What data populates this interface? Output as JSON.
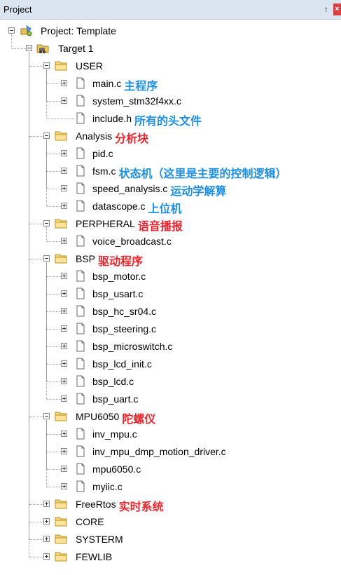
{
  "panel": {
    "title": "Project",
    "pin_glyph": "ᵖ",
    "close_glyph": "×"
  },
  "tree": [
    {
      "label": "Project: Template",
      "icon": "project-icon",
      "expander": "minus",
      "level": 0
    },
    {
      "label": "Target 1",
      "icon": "target-icon",
      "expander": "minus",
      "level": 1
    },
    {
      "label": "USER",
      "icon": "folder-icon",
      "expander": "minus",
      "level": 2
    },
    {
      "label": "main.c",
      "icon": "file-icon",
      "expander": "plus",
      "level": 3,
      "note": "主程序",
      "note_color": "blue"
    },
    {
      "label": "system_stm32f4xx.c",
      "icon": "file-icon",
      "expander": "plus",
      "level": 3
    },
    {
      "label": "include.h",
      "icon": "file-icon",
      "expander": "none",
      "level": 3,
      "note": "所有的头文件",
      "note_color": "blue"
    },
    {
      "label": "Analysis",
      "icon": "folder-icon",
      "expander": "minus",
      "level": 2,
      "note": "分析块",
      "note_color": "red"
    },
    {
      "label": "pid.c",
      "icon": "file-icon",
      "expander": "plus",
      "level": 3
    },
    {
      "label": "fsm.c",
      "icon": "file-icon",
      "expander": "plus",
      "level": 3,
      "note": "状态机（这里是主要的控制逻辑）",
      "note_color": "blue"
    },
    {
      "label": "speed_analysis.c",
      "icon": "file-icon",
      "expander": "plus",
      "level": 3,
      "note": "运动学解算",
      "note_color": "blue"
    },
    {
      "label": "datascope.c",
      "icon": "file-icon",
      "expander": "plus",
      "level": 3,
      "note": "上位机",
      "note_color": "blue"
    },
    {
      "label": "PERPHERAL",
      "icon": "folder-icon",
      "expander": "minus",
      "level": 2,
      "note": "语音播报",
      "note_color": "red"
    },
    {
      "label": "voice_broadcast.c",
      "icon": "file-icon",
      "expander": "plus",
      "level": 3
    },
    {
      "label": "BSP",
      "icon": "folder-icon",
      "expander": "minus",
      "level": 2,
      "note": "驱动程序",
      "note_color": "red"
    },
    {
      "label": "bsp_motor.c",
      "icon": "file-icon",
      "expander": "plus",
      "level": 3
    },
    {
      "label": "bsp_usart.c",
      "icon": "file-icon",
      "expander": "plus",
      "level": 3
    },
    {
      "label": "bsp_hc_sr04.c",
      "icon": "file-icon",
      "expander": "plus",
      "level": 3
    },
    {
      "label": "bsp_steering.c",
      "icon": "file-icon",
      "expander": "plus",
      "level": 3
    },
    {
      "label": "bsp_microswitch.c",
      "icon": "file-icon",
      "expander": "plus",
      "level": 3
    },
    {
      "label": "bsp_lcd_init.c",
      "icon": "file-icon",
      "expander": "plus",
      "level": 3
    },
    {
      "label": "bsp_lcd.c",
      "icon": "file-icon",
      "expander": "plus",
      "level": 3
    },
    {
      "label": "bsp_uart.c",
      "icon": "file-icon",
      "expander": "plus",
      "level": 3
    },
    {
      "label": "MPU6050",
      "icon": "folder-icon",
      "expander": "minus",
      "level": 2,
      "note": "陀螺仪",
      "note_color": "red"
    },
    {
      "label": "inv_mpu.c",
      "icon": "file-icon",
      "expander": "plus",
      "level": 3
    },
    {
      "label": "inv_mpu_dmp_motion_driver.c",
      "icon": "file-icon",
      "expander": "plus",
      "level": 3
    },
    {
      "label": "mpu6050.c",
      "icon": "file-icon",
      "expander": "plus",
      "level": 3
    },
    {
      "label": "myiic.c",
      "icon": "file-icon",
      "expander": "plus",
      "level": 3
    },
    {
      "label": "FreeRtos",
      "icon": "folder-icon",
      "expander": "plus",
      "level": 2,
      "note": "实时系统",
      "note_color": "red"
    },
    {
      "label": "CORE",
      "icon": "folder-icon",
      "expander": "plus",
      "level": 2
    },
    {
      "label": "SYSTERM",
      "icon": "folder-icon",
      "expander": "plus",
      "level": 2
    },
    {
      "label": "FEWLIB",
      "icon": "folder-icon",
      "expander": "plus",
      "level": 2
    }
  ]
}
